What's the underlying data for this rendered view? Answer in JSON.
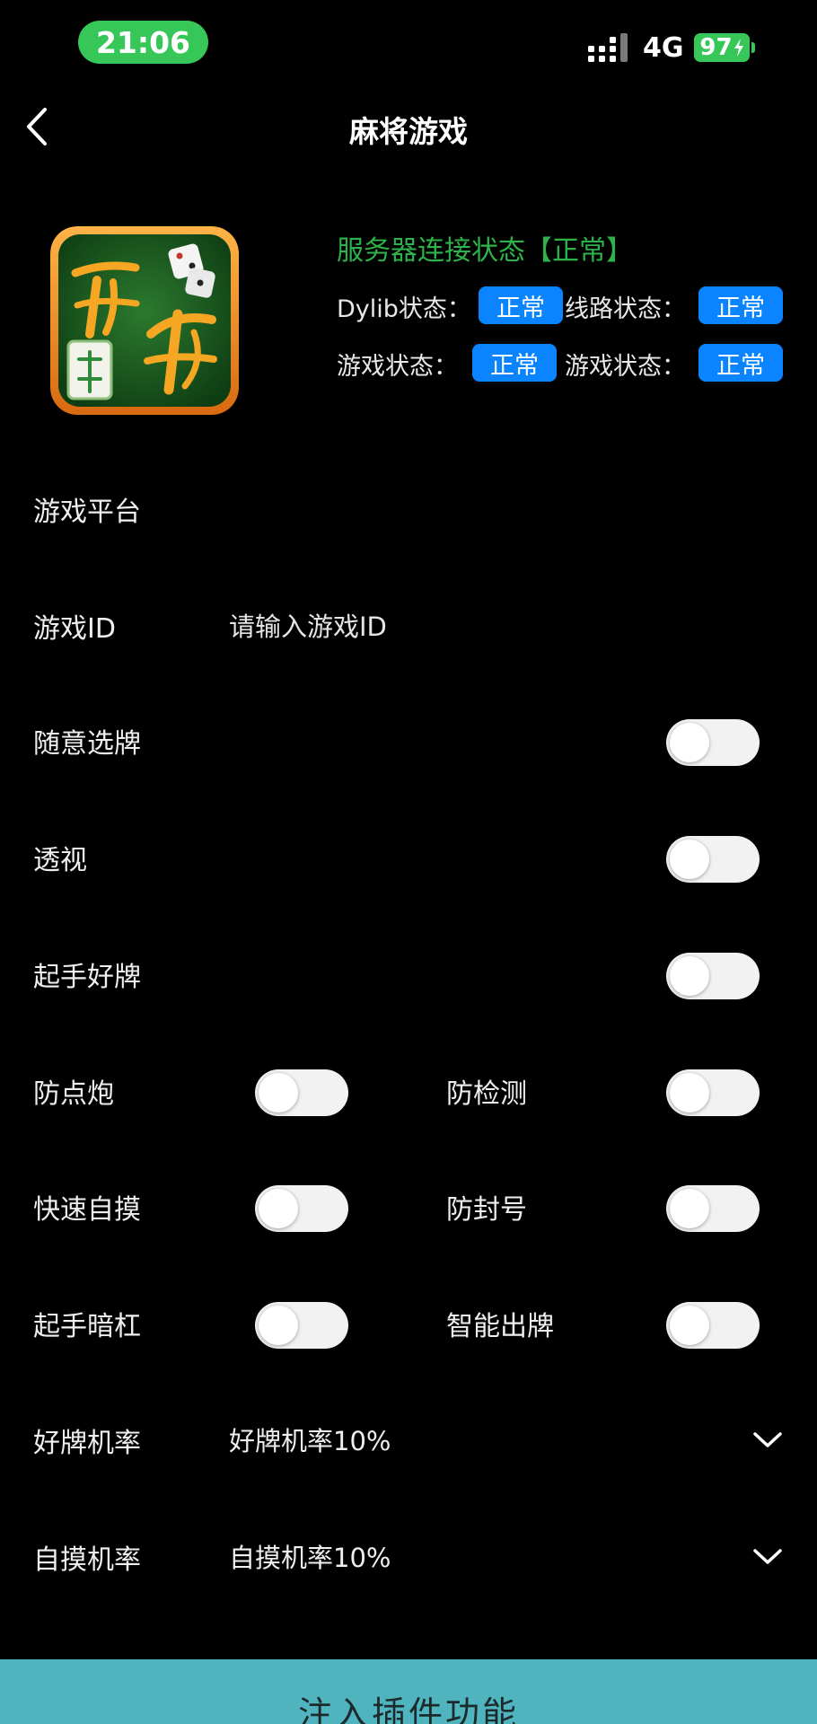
{
  "status_bar": {
    "time": "21:06",
    "network": "4G",
    "battery": "97",
    "colors": {
      "time_pill": "#37c759",
      "battery": "#37c759"
    }
  },
  "nav": {
    "title": "麻将游戏",
    "back_icon": "chevron-left-icon"
  },
  "header": {
    "server_status": "服务器连接状态【正常】",
    "stats": [
      {
        "label": "Dylib状态：",
        "value": "正常"
      },
      {
        "label": "线路状态：",
        "value": "正常"
      },
      {
        "label": "游戏状态：",
        "value": "正常"
      },
      {
        "label": "游戏状态：",
        "value": "正常"
      }
    ],
    "colors": {
      "server_status": "#2db34a",
      "badge": "#0a84ff"
    }
  },
  "form": {
    "platform_label": "游戏平台",
    "game_id_label": "游戏ID",
    "game_id_placeholder": "请输入游戏ID",
    "toggles": {
      "random_pick": {
        "label": "随意选牌",
        "on": false
      },
      "see_through": {
        "label": "透视",
        "on": false
      },
      "good_start": {
        "label": "起手好牌",
        "on": false
      },
      "anti_discard": {
        "label": "防点炮",
        "on": false
      },
      "anti_detect": {
        "label": "防检测",
        "on": false
      },
      "quick_self_draw": {
        "label": "快速自摸",
        "on": false
      },
      "anti_ban": {
        "label": "防封号",
        "on": false
      },
      "start_concealed_kong": {
        "label": "起手暗杠",
        "on": false
      },
      "smart_play": {
        "label": "智能出牌",
        "on": false
      }
    },
    "good_tile_rate": {
      "label": "好牌机率",
      "value": "好牌机率10%"
    },
    "self_draw_rate": {
      "label": "自摸机率",
      "value": "自摸机率10%"
    }
  },
  "footer": {
    "inject_label": "注入插件功能",
    "color": "#4fb4be"
  }
}
